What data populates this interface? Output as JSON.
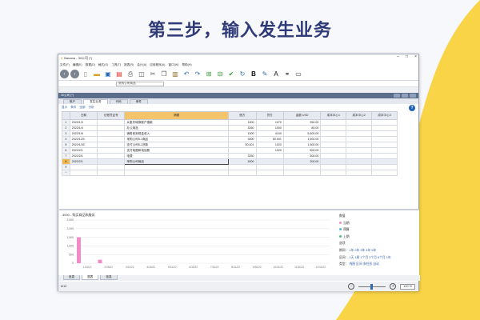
{
  "headline": "第三步，输入发生业务",
  "colors": {
    "accent": "#2f3a78",
    "yellow": "#f9d447",
    "selected_row": "#f2b84b",
    "bar": "#f28ac8"
  },
  "window": {
    "title": "Banana - 30公司 (*)",
    "menu": [
      "文件(F)",
      "编辑(E)",
      "数据(D)",
      "格式(O)",
      "工具(T)",
      "报表(R)",
      "会计(A)",
      "应用程序(A)",
      "窗口(W)",
      "帮助(H)"
    ],
    "toolbar_icons": [
      "back-icon",
      "forward-icon",
      "new-file-icon",
      "open-folder-icon",
      "save-icon",
      "pdf-icon",
      "print-icon",
      "print-preview-icon",
      "cut-icon",
      "copy-icon",
      "paste-icon",
      "undo-icon",
      "redo-icon",
      "add-row-icon",
      "delete-row-icon",
      "check-icon",
      "recalculate-icon",
      "bold-icon",
      "highlighter-icon",
      "font-color-icon",
      "binoculars-icon",
      "layout-icon"
    ],
    "address_value": "采购公司商品"
  },
  "subwindow": {
    "title": "30公司 (*)",
    "tabs": [
      "账户",
      "发生业务",
      "代码",
      "单件"
    ],
    "active_tab": 1,
    "actions": [
      "显示",
      "条件",
      "全部",
      "分析"
    ]
  },
  "table": {
    "headers": [
      "",
      "日期",
      "记账凭证号",
      "摘要",
      "借方",
      "贷方",
      "金额 USD",
      "成本中心1",
      "成本中心2",
      "成本中心3"
    ],
    "rows": [
      {
        "n": "1",
        "date": "2022/1/3",
        "doc": "",
        "desc": "从股东转换账户借款",
        "debit": "1000",
        "credit": "1070",
        "amount": "350.00"
      },
      {
        "n": "2",
        "date": "2022/1/4",
        "doc": "",
        "desc": "办公用品",
        "debit": "3260",
        "credit": "1000",
        "amount": "80.00"
      },
      {
        "n": "3",
        "date": "2022/1/6",
        "doc": "",
        "desc": "销售收到现金收入",
        "debit": "1000",
        "credit": "4100",
        "amount": "5,600.00"
      },
      {
        "n": "4",
        "date": "2022/1/20",
        "doc": "",
        "desc": "采购公司5-1商品",
        "debit": "3000",
        "credit": "50.001",
        "amount": "1,500.00"
      },
      {
        "n": "5",
        "date": "2022/1/30",
        "doc": "",
        "desc": "支付公司5-1货款",
        "debit": "50.001",
        "credit": "1020",
        "amount": "1,500.00"
      },
      {
        "n": "6",
        "date": "2022/2/1",
        "doc": "",
        "desc": "支付电费和电话费",
        "debit": "",
        "credit": "1020",
        "amount": "500.00"
      },
      {
        "n": "7",
        "date": "2022/2/1",
        "doc": "",
        "desc": "电费",
        "debit": "3250",
        "credit": "",
        "amount": "300.00"
      },
      {
        "n": "8",
        "date": "2022/2/1",
        "doc": "",
        "desc": "采购公司商品",
        "debit": "3000",
        "credit": "",
        "amount": "200.00"
      },
      {
        "n": "9",
        "date": "",
        "doc": "",
        "desc": "",
        "debit": "",
        "credit": "",
        "amount": ""
      },
      {
        "n": "*",
        "date": "",
        "doc": "",
        "desc": "",
        "debit": "",
        "credit": "",
        "amount": ""
      }
    ]
  },
  "panel": {
    "chart_title": "3000 - 购买商品和服务",
    "legend_title": "数值",
    "legend": [
      {
        "name": "当期",
        "color": "#f28ac8"
      },
      {
        "name": "预算",
        "color": "#4fb7e0"
      },
      {
        "name": "上期",
        "color": "#4bbf7a"
      }
    ],
    "options_title": "选项",
    "period_label": "期间：",
    "periods": [
      "1年",
      "2年",
      "3年",
      "4年",
      "5年"
    ],
    "interval_label": "区间：",
    "intervals": [
      "1天",
      "1周",
      "1个月",
      "3个月",
      "6个月",
      "1年"
    ],
    "type_label": "类型：",
    "types": [
      "线图",
      "区间",
      "多柱形",
      "自动"
    ]
  },
  "chart_data": {
    "type": "bar",
    "title": "3000 - 购买商品和服务",
    "y_ticks": [
      "2,500",
      "2,000",
      "1,500",
      "1,000",
      "500",
      "0"
    ],
    "ylim": [
      0,
      2500
    ],
    "categories": [
      "1/31/22",
      "2/28/22",
      "3/31/22",
      "4/30/22",
      "5/31/22",
      "6/30/22",
      "7/31/22",
      "8/31/22",
      "9/30/22",
      "10/31/22",
      "11/30/22",
      "12/31/22"
    ],
    "series": [
      {
        "name": "当期",
        "values": [
          1500,
          200,
          0,
          0,
          0,
          0,
          0,
          0,
          0,
          0,
          0,
          0
        ]
      }
    ]
  },
  "bottom_tabs": [
    "信息",
    "图表",
    "信息"
  ],
  "status": {
    "left": "8/10",
    "zoom": "100 %"
  }
}
